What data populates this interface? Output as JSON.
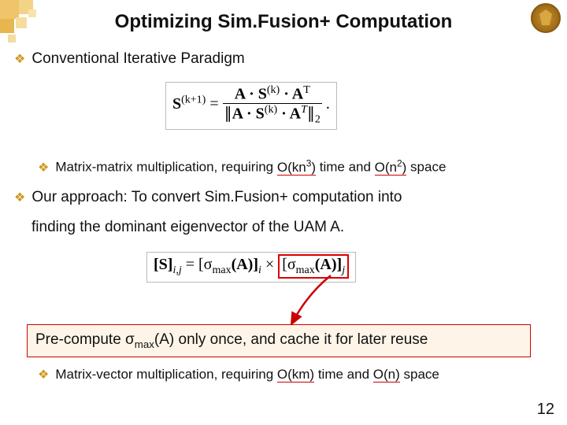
{
  "slide": {
    "title": "Optimizing Sim.Fusion+ Computation",
    "pagenum": "12"
  },
  "conventional": {
    "heading": "Conventional Iterative Paradigm",
    "subpoint_prefix": "Matrix-matrix multiplication,   requiring ",
    "on_km3": "O(kn",
    "on_km3_sup": "3",
    "on_km3_tail": ")",
    "mid": " time and ",
    "on_n2": "O(n",
    "on_n2_sup": "2",
    "on_n2_tail": ")",
    "on_tail": " space"
  },
  "formula1": {
    "lhs_S": "S",
    "lhs_sup": "(k+1)",
    "eq": " = ",
    "num_A": "A · S",
    "num_sup": "(k)",
    "num_tail": " · A",
    "num_T": "T",
    "den_open": "∥",
    "den_A": "A · S",
    "den_sup": "(k)",
    "den_tail": " · A",
    "den_T": "T",
    "den_close": "∥",
    "den_sub": "2",
    "period": "."
  },
  "approach": {
    "line1": "Our approach:  To convert Sim.Fusion+ computation into",
    "line2": "finding the dominant eigenvector of the UAM A."
  },
  "formula2": {
    "lhs": "[S]",
    "lhs_sub": "i,j",
    "eq": " = [σ",
    "max1_sub": "max",
    "A1": "(A)]",
    "i_sub": "i",
    "times": " × ",
    "open2": "[σ",
    "max2_sub": "max",
    "A2": "(A)]",
    "j_sub": "j"
  },
  "precompute": {
    "prefix": "Pre-compute σ",
    "sub": "max",
    "mid": "(A) only once, and cache it for later reuse"
  },
  "bottom": {
    "prefix": "Matrix-vector multiplication,   requiring ",
    "okm": "O(km)",
    "mid": " time and ",
    "on": "O(n)",
    "tail": " space"
  }
}
